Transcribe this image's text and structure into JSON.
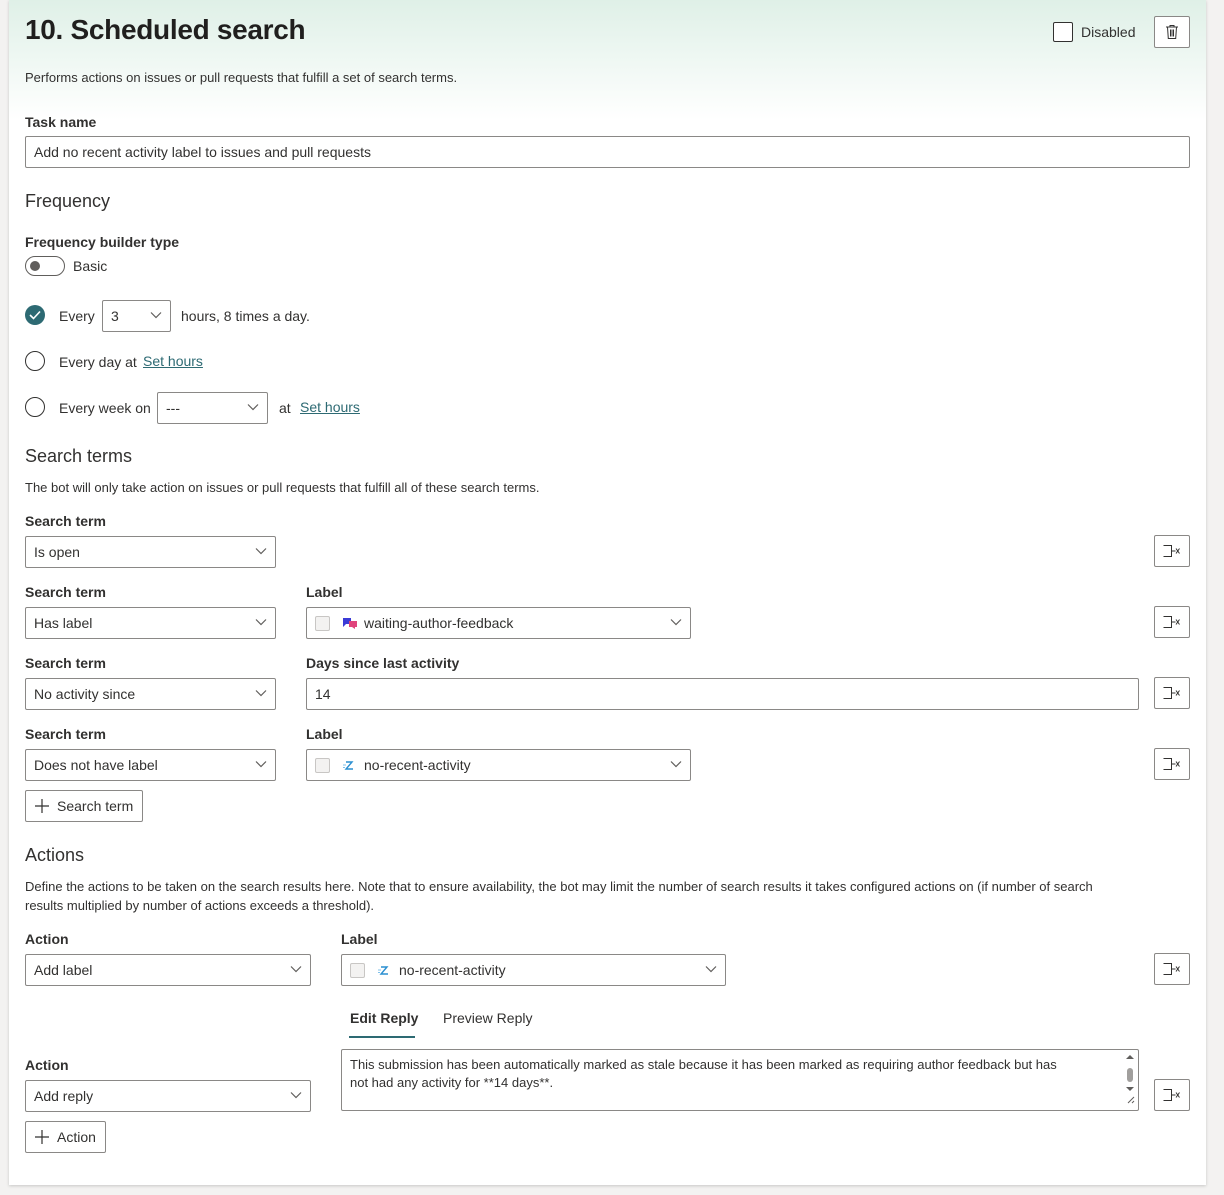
{
  "task": {
    "title": "10. Scheduled search",
    "description": "Performs actions on issues or pull requests that fulfill a set of search terms.",
    "disabled_label": "Disabled"
  },
  "task_name": {
    "label": "Task name",
    "value": "Add no recent activity label to issues and pull requests"
  },
  "frequency": {
    "section_title": "Frequency",
    "builder_label": "Frequency builder type",
    "builder_toggle_text": "Basic",
    "option_every": {
      "prefix": "Every",
      "value": "3",
      "suffix": "hours, 8 times a day.",
      "selected": true
    },
    "option_daily": {
      "prefix": "Every day at",
      "link": "Set hours"
    },
    "option_weekly": {
      "prefix": "Every week on",
      "value": "---",
      "at": "at",
      "link": "Set hours"
    }
  },
  "search_terms": {
    "section_title": "Search terms",
    "description": "The bot will only take action on issues or pull requests that fulfill all of these search terms.",
    "rows": [
      {
        "label": "Search term",
        "value": "Is open"
      },
      {
        "label": "Search term",
        "value": "Has label",
        "extra_label": "Label",
        "extra_value": "waiting-author-feedback"
      },
      {
        "label": "Search term",
        "value": "No activity since",
        "extra_label": "Days since last activity",
        "extra_value": "14"
      },
      {
        "label": "Search term",
        "value": "Does not have label",
        "extra_label": "Label",
        "extra_value": "no-recent-activity"
      }
    ],
    "add_button": "Search term"
  },
  "actions": {
    "section_title": "Actions",
    "description_line1": "Define the actions to be taken on the search results here. Note that to ensure availability, the bot may limit the number of search results it takes configured actions on (if number of search",
    "description_line2": "results multiplied by number of actions exceeds a threshold).",
    "rows": [
      {
        "label": "Action",
        "value": "Add label",
        "extra_label": "Label",
        "extra_value": "no-recent-activity"
      },
      {
        "label": "Action",
        "value": "Add reply"
      }
    ],
    "tabs": [
      "Edit Reply",
      "Preview Reply"
    ],
    "active_tab": "Edit Reply",
    "reply_text_line1": "This submission has been automatically marked as stale because it has been marked as requiring author feedback but has",
    "reply_text_line2": "not had any activity for **14 days**.",
    "add_button": "Action"
  },
  "colors": {
    "accent": "#2d6a73",
    "header_gradient_top": "#dff0e7",
    "label_icon_waiting": "#3b3bd6",
    "label_icon_norecent": "#2a8fd1"
  },
  "icons": {
    "delete": "trash-icon",
    "remove_row": "remove-row-icon",
    "dropdown": "chevron-down-icon",
    "add": "plus-icon",
    "check": "checkmark-icon"
  }
}
